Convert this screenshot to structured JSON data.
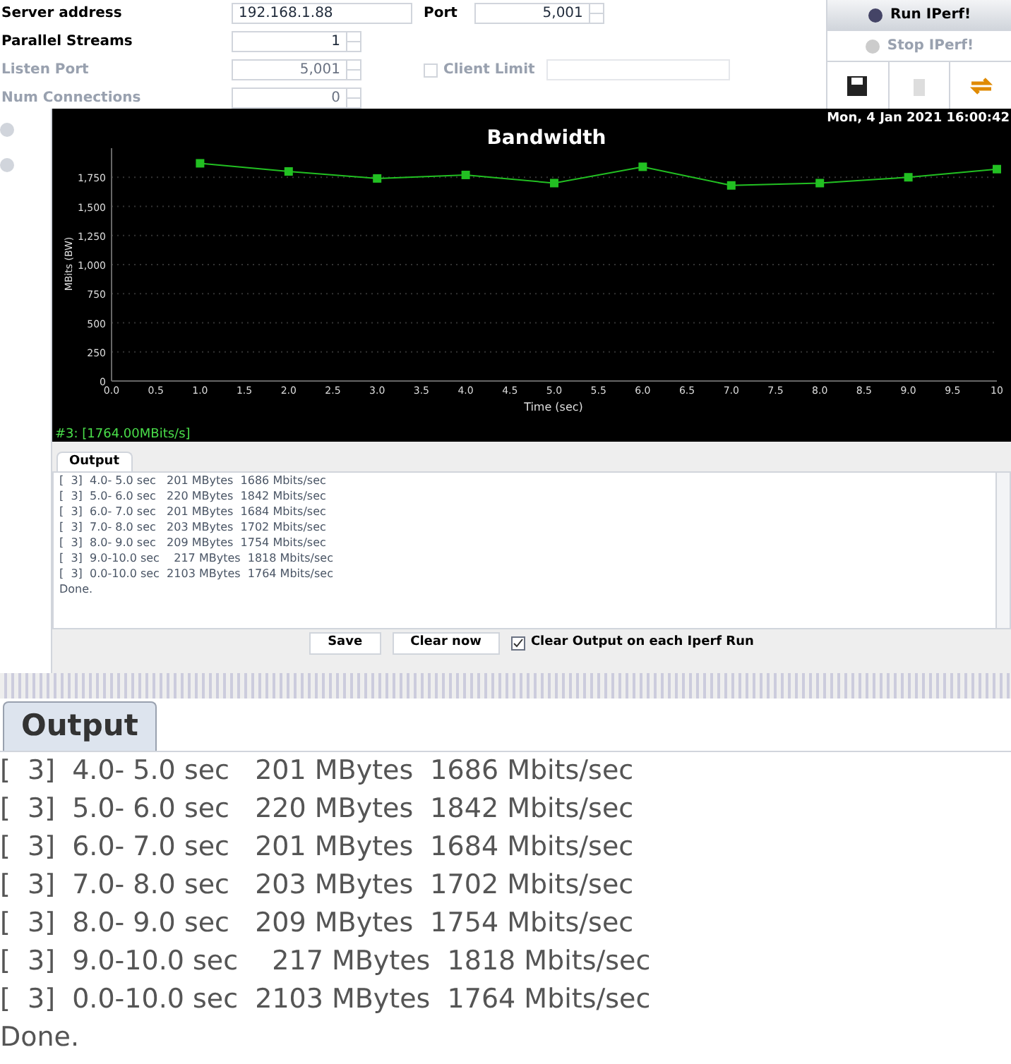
{
  "form": {
    "fields": [
      {
        "kind": "text",
        "label": "Server address",
        "value": "192.168.1.88",
        "disabled": false
      },
      {
        "kind": "spinner",
        "label": "Port",
        "value": "5,001",
        "disabled": false
      },
      {
        "kind": "spinner",
        "label": "Parallel Streams",
        "value": "1",
        "disabled": false
      },
      {
        "kind": "spinner",
        "label": "Listen Port",
        "value": "5,001",
        "disabled": true
      },
      {
        "kind": "checkbox",
        "label": "Client Limit",
        "checked": false,
        "disabled": true
      },
      {
        "kind": "spinner",
        "label": "Num Connections",
        "value": "0",
        "disabled": true
      }
    ]
  },
  "actions": [
    {
      "label": "Run IPerf!",
      "disabled": false
    },
    {
      "label": "Stop IPerf!",
      "disabled": true
    }
  ],
  "chart": {
    "timestamp": "Mon, 4 Jan 2021 16:00:42",
    "legend": "#3: [1764.00MBits/s]",
    "chart_data": {
      "type": "line",
      "title": "Bandwidth",
      "xlabel": "Time (sec)",
      "ylabel": "MBits (BW)",
      "x": [
        1,
        2,
        3,
        4,
        5,
        6,
        7,
        8,
        9,
        10
      ],
      "series": [
        {
          "color": "#22c022",
          "marker": "square",
          "values": [
            1870,
            1800,
            1740,
            1770,
            1700,
            1840,
            1680,
            1700,
            1750,
            1820
          ]
        }
      ],
      "grid": true,
      "xlim": [
        0,
        10
      ],
      "ylim": [
        0,
        2000
      ],
      "xticks": [
        {
          "value": 0,
          "label": "0.0"
        },
        {
          "value": 0.5,
          "label": "0.5"
        },
        {
          "value": 1,
          "label": "1.0"
        },
        {
          "value": 1.5,
          "label": "1.5"
        },
        {
          "value": 2,
          "label": "2.0"
        },
        {
          "value": 2.5,
          "label": "2.5"
        },
        {
          "value": 3,
          "label": "3.0"
        },
        {
          "value": 3.5,
          "label": "3.5"
        },
        {
          "value": 4,
          "label": "4.0"
        },
        {
          "value": 4.5,
          "label": "4.5"
        },
        {
          "value": 5,
          "label": "5.0"
        },
        {
          "value": 5.5,
          "label": "5.5"
        },
        {
          "value": 6,
          "label": "6.0"
        },
        {
          "value": 6.5,
          "label": "6.5"
        },
        {
          "value": 7,
          "label": "7.0"
        },
        {
          "value": 7.5,
          "label": "7.5"
        },
        {
          "value": 8,
          "label": "8.0"
        },
        {
          "value": 8.5,
          "label": "8.5"
        },
        {
          "value": 9,
          "label": "9.0"
        },
        {
          "value": 9.5,
          "label": "9.5"
        },
        {
          "value": 10,
          "label": "10"
        }
      ],
      "yticks": [
        {
          "value": 0,
          "label": "0"
        },
        {
          "value": 250,
          "label": "250"
        },
        {
          "value": 500,
          "label": "500"
        },
        {
          "value": 750,
          "label": "750"
        },
        {
          "value": 1000,
          "label": "1,000"
        },
        {
          "value": 1250,
          "label": "1,250"
        },
        {
          "value": 1500,
          "label": "1,500"
        },
        {
          "value": 1750,
          "label": "1,750"
        }
      ]
    }
  },
  "output": {
    "tab": "Output",
    "lines": [
      "[  3]  4.0- 5.0 sec   201 MBytes  1686 Mbits/sec",
      "[  3]  5.0- 6.0 sec   220 MBytes  1842 Mbits/sec",
      "[  3]  6.0- 7.0 sec   201 MBytes  1684 Mbits/sec",
      "[  3]  7.0- 8.0 sec   203 MBytes  1702 Mbits/sec",
      "[  3]  8.0- 9.0 sec   209 MBytes  1754 Mbits/sec",
      "[  3]  9.0-10.0 sec    217 MBytes  1818 Mbits/sec",
      "[  3]  0.0-10.0 sec  2103 MBytes  1764 Mbits/sec",
      "Done."
    ],
    "buttons": [
      "Save",
      "Clear now"
    ],
    "clear_on_run": {
      "label": "Clear Output on each Iperf Run",
      "checked": true
    }
  },
  "zoomed_output": {
    "tab": "Output",
    "lines": [
      "[  3]  4.0- 5.0 sec   201 MBytes  1686 Mbits/sec",
      "[  3]  5.0- 6.0 sec   220 MBytes  1842 Mbits/sec",
      "[  3]  6.0- 7.0 sec   201 MBytes  1684 Mbits/sec",
      "[  3]  7.0- 8.0 sec   203 MBytes  1702 Mbits/sec",
      "[  3]  8.0- 9.0 sec   209 MBytes  1754 Mbits/sec",
      "[  3]  9.0-10.0 sec    217 MBytes  1818 Mbits/sec",
      "[  3]  0.0-10.0 sec  2103 MBytes  1764 Mbits/sec",
      "Done."
    ]
  }
}
